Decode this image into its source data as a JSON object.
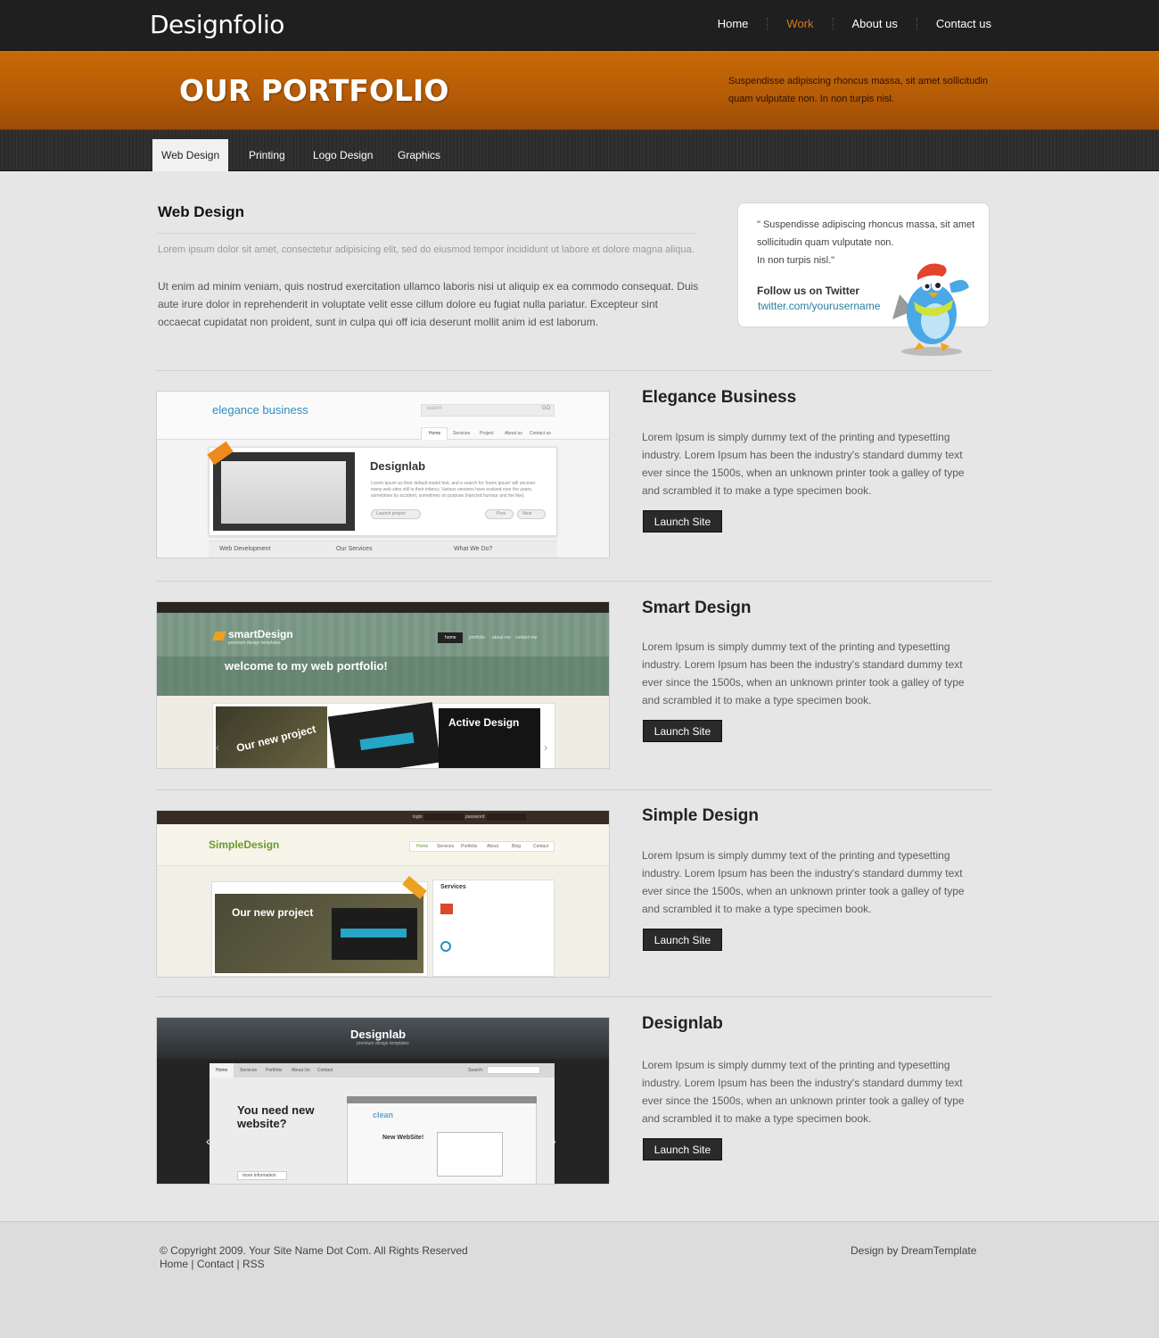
{
  "header": {
    "logo": "Designfolio",
    "nav": [
      {
        "label": "Home"
      },
      {
        "label": "Work",
        "active": true
      },
      {
        "label": "About us"
      },
      {
        "label": "Contact us"
      }
    ]
  },
  "banner": {
    "title": "OUR PORTFOLIO",
    "text": "Suspendisse adipiscing rhoncus massa, sit amet sollicitudin quam vulputate non. In non turpis nisl."
  },
  "subnav": {
    "tabs": [
      {
        "label": "Web Design",
        "active": true
      },
      {
        "label": "Printing"
      },
      {
        "label": "Logo Design"
      },
      {
        "label": "Graphics"
      }
    ]
  },
  "intro": {
    "title": "Web Design",
    "lead": "Lorem ipsum dolor sit amet, consectetur adipisicing elit, sed do eiusmod tempor incididunt ut labore et dolore magna aliqua.",
    "body": "Ut enim ad minim veniam, quis nostrud exercitation ullamco laboris nisi ut aliquip ex ea commodo consequat. Duis aute irure dolor in reprehenderit in voluptate velit esse cillum dolore eu fugiat nulla pariatur. Excepteur sint occaecat cupidatat non proident, sunt in culpa qui off icia deserunt mollit anim id est laborum."
  },
  "twitter": {
    "quote": "\" Suspendisse adipiscing rhoncus massa, sit amet sollicitudin quam vulputate non.\nIn non turpis nisl.\"",
    "follow": "Follow us on Twitter",
    "link": "twitter.com/yourusername"
  },
  "items": [
    {
      "title": "Elegance Business",
      "desc": "Lorem Ipsum is simply dummy text of the printing and typesetting industry. Lorem Ipsum has been the industry's standard dummy text ever since the 1500s, when an unknown printer took a galley of type and scrambled it to make a type specimen book.",
      "button": "Launch Site",
      "shot": {
        "brand": "elegance business",
        "search": "search",
        "go": "GO",
        "tabs": [
          "Home",
          "Services",
          "Project",
          "About us",
          "Contact us"
        ],
        "feature_title": "Designlab",
        "feature_text": "Lorem ipsum as their default model text, and a search for 'lorem ipsum' will uncover many web sites still in their infancy. Various versions have evolved over the years, sometimes by accident, sometimes on purpose (injected humour and the like).",
        "launch": "Launch project",
        "prev": "Prev",
        "next": "Next",
        "footer_tabs": [
          "Web Development",
          "Our Services",
          "What We Do?"
        ]
      }
    },
    {
      "title": "Smart Design",
      "desc": "Lorem Ipsum is simply dummy text of the printing and typesetting industry. Lorem Ipsum has been the industry's standard dummy text ever since the 1500s, when an unknown printer took a galley of type and scrambled it to make a type specimen book.",
      "button": "Launch Site",
      "shot": {
        "brand": "smartDesign",
        "tagline": "premium design templates",
        "nav": [
          "home",
          "portfolio",
          "about me",
          "contact me"
        ],
        "headline": "welcome to my web portfolio!",
        "project": "Our new project",
        "active": "Active Design"
      }
    },
    {
      "title": "Simple Design",
      "desc": "Lorem Ipsum is simply dummy text of the printing and typesetting industry. Lorem Ipsum has been the industry's standard dummy text ever since the 1500s, when an unknown printer took a galley of type and scrambled it to make a type specimen book.",
      "button": "Launch Site",
      "shot": {
        "brand": "SimpleDesign",
        "login": "login",
        "password": "password",
        "nav": [
          "Home",
          "Services",
          "Portfolio",
          "About",
          "Blog",
          "Contact"
        ],
        "project": "Our new project",
        "services": "Services"
      }
    },
    {
      "title": "Designlab",
      "desc": "Lorem Ipsum is simply dummy text of the printing and typesetting industry. Lorem Ipsum has been the industry's standard dummy text ever since the 1500s, when an unknown printer took a galley of type and scrambled it to make a type specimen book.",
      "button": "Launch Site",
      "shot": {
        "brand": "Designlab",
        "tagline": "premium design templates",
        "nav": [
          "Home",
          "Services",
          "Portfolio",
          "About Us",
          "Contact"
        ],
        "search": "Search:",
        "headline": "You need new website?",
        "more": "more information",
        "inner_brand": "clean",
        "inner_title": "New WebSite!"
      }
    }
  ],
  "footer": {
    "copyright": "© Copyright 2009. Your Site Name Dot Com. All Rights Reserved",
    "links": [
      "Home",
      "Contact",
      "RSS"
    ],
    "credit": "Design by DreamTemplate"
  },
  "colors": {
    "accent": "#d47a1c",
    "banner": "#b55c07",
    "dark": "#1f1f1f",
    "link": "#2a7fa0"
  }
}
